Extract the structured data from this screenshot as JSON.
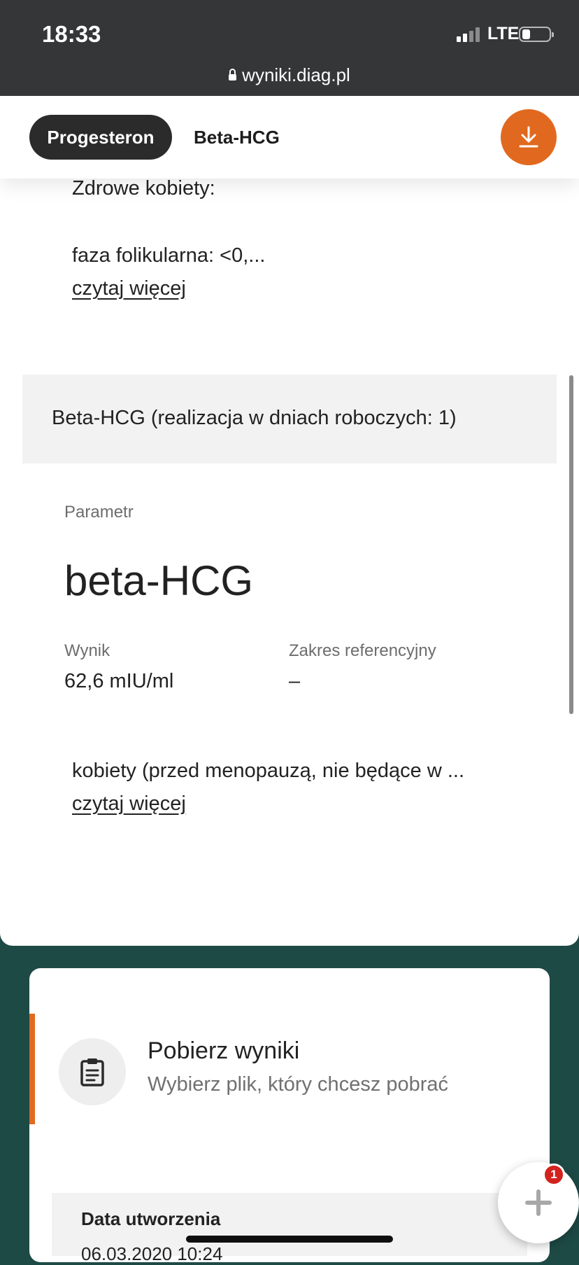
{
  "status_bar": {
    "time": "18:33",
    "network": "LTE"
  },
  "browser": {
    "url": "wyniki.diag.pl"
  },
  "tabs": [
    {
      "label": "Progesteron",
      "active": true
    },
    {
      "label": "Beta-HCG",
      "active": false
    }
  ],
  "progesteron": {
    "ref_line1": "Zdrowe kobiety:",
    "ref_line2": "faza folikularna: <0,...",
    "read_more": "czytaj więcej"
  },
  "beta_hcg": {
    "section_title": "Beta-HCG (realizacja w dniach roboczych: 1)",
    "param_label": "Parametr",
    "param_name": "beta-HCG",
    "result_label": "Wynik",
    "result_value": "62,6 mIU/ml",
    "range_label": "Zakres referencyjny",
    "range_value": "–",
    "note": "kobiety (przed menopauzą, nie będące w ...",
    "read_more": "czytaj więcej"
  },
  "download_panel": {
    "title": "Pobierz wyniki",
    "subtitle": "Wybierz plik, który chcesz pobrać",
    "table_header": "Data utworzenia",
    "first_row_partial": "06.03.2020 10:24"
  },
  "fab": {
    "badge_count": "1"
  },
  "colors": {
    "accent": "#e1691f",
    "dark_tab": "#2b2b2b",
    "page_bg": "#1e4a46",
    "badge": "#d2231e"
  },
  "icons": {
    "download": "download-icon",
    "clipboard": "clipboard-icon",
    "plus": "plus-icon",
    "lock": "lock-icon"
  }
}
